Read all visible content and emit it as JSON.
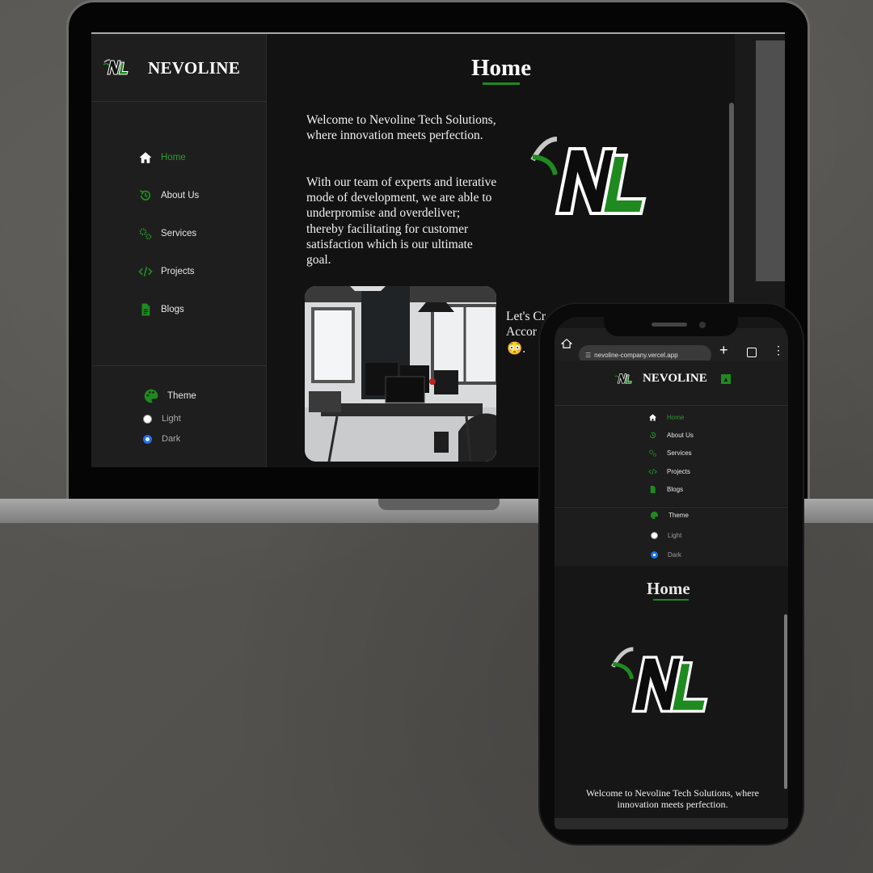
{
  "laptop": {
    "brand": "NEVOLINE",
    "nav": [
      {
        "label": "Home",
        "icon": "home-icon",
        "active": true
      },
      {
        "label": "About Us",
        "icon": "history-icon",
        "active": false
      },
      {
        "label": "Services",
        "icon": "gears-icon",
        "active": false
      },
      {
        "label": "Projects",
        "icon": "code-icon",
        "active": false
      },
      {
        "label": "Blogs",
        "icon": "document-icon",
        "active": false
      }
    ],
    "theme": {
      "label": "Theme",
      "options": [
        "Light",
        "Dark"
      ],
      "selected": "Dark"
    },
    "main": {
      "title": "Home",
      "para1": "Welcome to Nevoline Tech Solutions, where innovation meets perfection.",
      "para2": "With our team of experts and iterative mode of development, we are able to underpromise and overdeliver; thereby facilitating for customer satisfaction which is our ultimate goal.",
      "partial_line1": "Let's Cr",
      "partial_line2": "Accor",
      "partial_line3": "😳."
    }
  },
  "phone": {
    "url": "nevoline-company.vercel.app",
    "brand": "NEVOLINE",
    "nav": [
      {
        "label": "Home",
        "icon": "home-icon",
        "active": true
      },
      {
        "label": "About Us",
        "icon": "history-icon",
        "active": false
      },
      {
        "label": "Services",
        "icon": "gears-icon",
        "active": false
      },
      {
        "label": "Projects",
        "icon": "code-icon",
        "active": false
      },
      {
        "label": "Blogs",
        "icon": "document-icon",
        "active": false
      }
    ],
    "theme": {
      "label": "Theme",
      "options": [
        "Light",
        "Dark"
      ],
      "selected": "Dark"
    },
    "title": "Home",
    "welcome": "Welcome to Nevoline Tech Solutions, where innovation meets perfection."
  },
  "colors": {
    "accent": "#1f8a1f",
    "background": "#121212",
    "sidebar": "#1e1e1e"
  }
}
